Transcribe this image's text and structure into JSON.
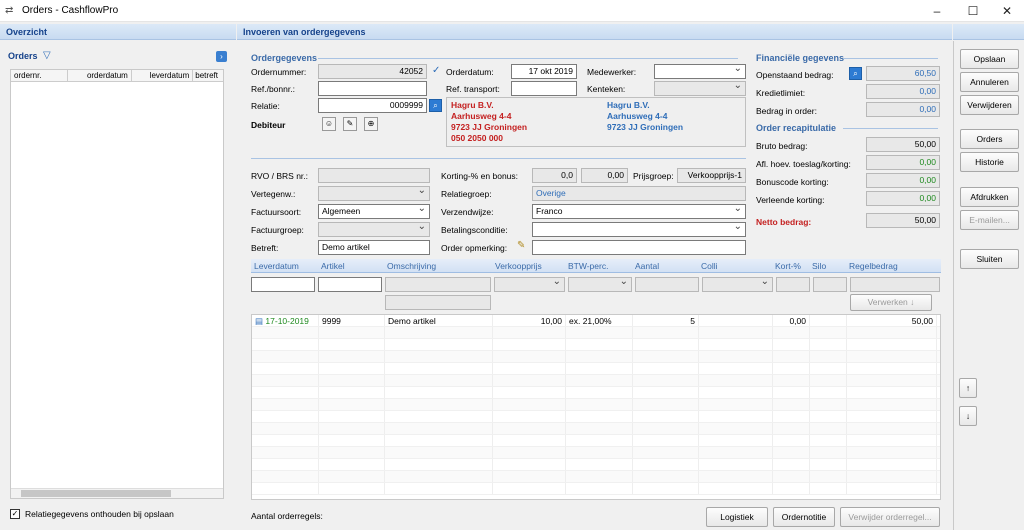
{
  "window": {
    "title": "Orders - CashflowPro"
  },
  "left": {
    "header": "Overzicht",
    "list_title": "Orders",
    "columns": [
      "ordernr.",
      "orderdatum",
      "leverdatum",
      "betreft"
    ],
    "remember_label": "Relatiegegevens onthouden bij opslaan"
  },
  "main": {
    "header": "Invoeren van ordergegevens",
    "ordergegevens": {
      "section": "Ordergegevens",
      "ordernummer_label": "Ordernummer:",
      "ordernummer": "42052",
      "orderdatum_label": "Orderdatum:",
      "orderdatum": "17 okt 2019",
      "medewerker_label": "Medewerker:",
      "medewerker": "",
      "ref_bonnr_label": "Ref./bonnr.:",
      "ref_bonnr": "",
      "ref_transport_label": "Ref. transport:",
      "ref_transport": "",
      "kenteken_label": "Kenteken:",
      "kenteken": "",
      "relatie_label": "Relatie:",
      "relatie": "0009999",
      "debiteur_label": "Debiteur"
    },
    "address_left": {
      "name": "Hagru B.V.",
      "street": "Aarhusweg 4-4",
      "city": "9723 JJ Groningen",
      "phone": "050 2050 000"
    },
    "address_right": {
      "name": "Hagru B.V.",
      "street": "Aarhusweg 4-4",
      "city": "9723 JJ  Groningen"
    },
    "details": {
      "rvo_label": "RVO / BRS nr.:",
      "rvo": "",
      "vertegenw_label": "Vertegenw.:",
      "vertegenw": "",
      "factuursoort_label": "Factuursoort:",
      "factuursoort": "Algemeen",
      "factuurgroep_label": "Factuurgroep:",
      "factuurgroep": "",
      "betreft_label": "Betreft:",
      "betreft": "Demo artikel",
      "korting_label": "Korting-% en bonus:",
      "korting1": "0,0",
      "korting2": "0,00",
      "prijsgroep_label": "Prijsgroep:",
      "prijsgroep": "Verkoopprijs-1",
      "relatiegroep_label": "Relatiegroep:",
      "relatiegroep": "Overige",
      "verzendwijze_label": "Verzendwijze:",
      "verzendwijze": "Franco",
      "betalingsconditie_label": "Betalingsconditie:",
      "betalingsconditie": "",
      "order_opmerking_label": "Order opmerking:",
      "order_opmerking": ""
    },
    "lines": {
      "columns": [
        "Leverdatum",
        "Artikel",
        "Omschrijving",
        "Verkoopprijs",
        "BTW-perc.",
        "Aantal",
        "Colli",
        "Kort-%",
        "Silo",
        "Regelbedrag"
      ],
      "verwerken_label": "Verwerken ↓",
      "rows": [
        {
          "leverdatum": "17-10-2019",
          "artikel": "9999",
          "omschrijving": "Demo artikel",
          "verkoopprijs": "10,00",
          "btw": "ex. 21,00%",
          "aantal": "5",
          "colli": "",
          "kort": "0,00",
          "silo": "",
          "regelbedrag": "50,00"
        }
      ]
    },
    "aantal_orderregels_label": "Aantal orderregels:",
    "bottom_buttons": {
      "logistiek": "Logistiek",
      "ordernotitie": "Ordernotitie",
      "verwijder_orderregel": "Verwijder orderregel..."
    }
  },
  "financial": {
    "section": "Financiële gegevens",
    "openstaand_label": "Openstaand bedrag:",
    "openstaand": "60,50",
    "kredietlimiet_label": "Kredietlimiet:",
    "kredietlimiet": "0,00",
    "bedrag_in_order_label": "Bedrag in order:",
    "bedrag_in_order": "0,00",
    "recap_section": "Order recapitulatie",
    "bruto_label": "Bruto bedrag:",
    "bruto": "50,00",
    "afl_label": "Afl. hoev. toeslag/korting:",
    "afl": "0,00",
    "bonuscode_label": "Bonuscode korting:",
    "bonuscode": "0,00",
    "verleende_label": "Verleende korting:",
    "verleende": "0,00",
    "netto_label": "Netto bedrag:",
    "netto": "50,00"
  },
  "actions": {
    "opslaan": "Opslaan",
    "annuleren": "Annuleren",
    "verwijderen": "Verwijderen",
    "orders": "Orders",
    "historie": "Historie",
    "afdrukken": "Afdrukken",
    "emailen": "E-mailen...",
    "sluiten": "Sluiten",
    "up": "↑",
    "down": "↓"
  }
}
